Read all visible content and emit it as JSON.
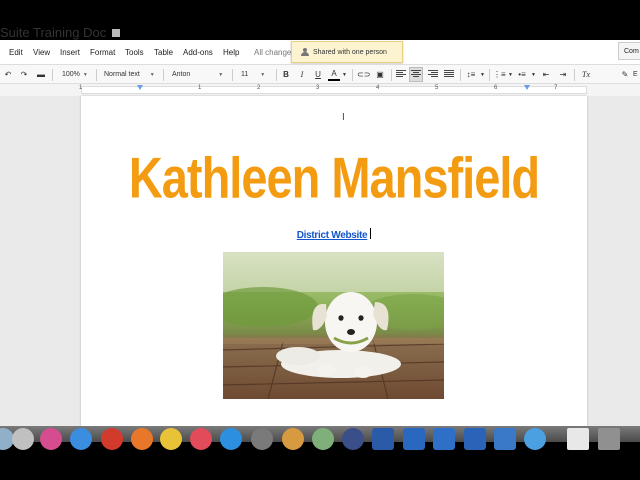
{
  "window": {
    "doc_title": "Suite Training Doc"
  },
  "menubar": {
    "items": [
      "Edit",
      "View",
      "Insert",
      "Format",
      "Tools",
      "Table",
      "Add-ons",
      "Help"
    ],
    "status": "All change"
  },
  "share_notice": {
    "text": "Shared with one person"
  },
  "comments_button": {
    "label": "Com"
  },
  "toolbar": {
    "zoom": "100%",
    "style": "Normal text",
    "font": "Anton",
    "size": "11",
    "bold": "B",
    "italic": "I",
    "underline": "U",
    "text_color": "A",
    "clear_format": "Tx",
    "edit_label": "E"
  },
  "ruler": {
    "numbers": [
      "1",
      "1",
      "2",
      "3",
      "4",
      "5",
      "6",
      "7"
    ]
  },
  "document": {
    "title": "Kathleen Mansfield",
    "link_text": "District Website"
  },
  "colors": {
    "title": "#f39c12",
    "link": "#1155cc",
    "share_bg": "#fcf4d0"
  }
}
